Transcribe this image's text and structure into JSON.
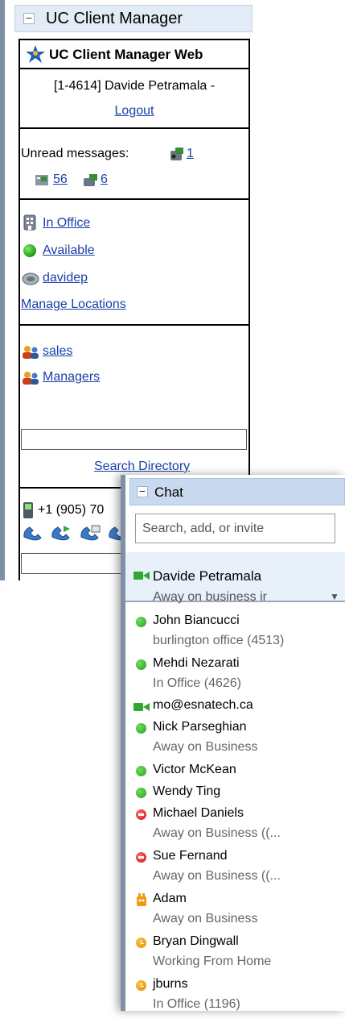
{
  "uc_gadget": {
    "title": "UC Client Manager",
    "app_title": "UC Client Manager Web",
    "user_line": "[1-4614] Davide Petramala -",
    "logout": "Logout",
    "unread_label": "Unread messages:",
    "voicemail_count": "1",
    "fax_count": "56",
    "email_count": "6",
    "location": "In Office",
    "presence": "Available",
    "username": "davidep",
    "manage_locations": "Manage Locations",
    "groups": [
      "sales",
      "Managers"
    ],
    "search_directory": "Search Directory",
    "phone_number": "+1 (905) 70",
    "dial_link": "D"
  },
  "chat_gadget": {
    "title": "Chat",
    "search_placeholder": "Search, add, or invite",
    "self": {
      "name": "Davide Petramala",
      "status": "Away on business ir"
    },
    "contacts": [
      {
        "name": "John Biancucci",
        "status": "burlington office (4513)",
        "presence": "available"
      },
      {
        "name": "Mehdi Nezarati",
        "status": "In Office (4626)",
        "presence": "available"
      },
      {
        "name": "mo@esnatech.ca",
        "status": "",
        "presence": "video"
      },
      {
        "name": "Nick Parseghian",
        "status": "Away on Business",
        "presence": "available"
      },
      {
        "name": "Victor McKean",
        "status": "",
        "presence": "available"
      },
      {
        "name": "Wendy Ting",
        "status": "",
        "presence": "available"
      },
      {
        "name": "Michael Daniels",
        "status": "Away on Business ((...",
        "presence": "busy"
      },
      {
        "name": "Sue Fernand",
        "status": "Away on Business ((...",
        "presence": "busy"
      },
      {
        "name": "Adam",
        "status": "Away on Business",
        "presence": "mobile"
      },
      {
        "name": "Bryan Dingwall",
        "status": "Working From Home",
        "presence": "idle"
      },
      {
        "name": "jburns",
        "status": "In Office (1196)",
        "presence": "idle"
      }
    ]
  },
  "colors": {
    "link": "#1a3fa8",
    "available": "#2fb524",
    "busy": "#d11d1d",
    "idle": "#f0a010",
    "video": "#2ea82e",
    "mobile": "#f09a10"
  }
}
